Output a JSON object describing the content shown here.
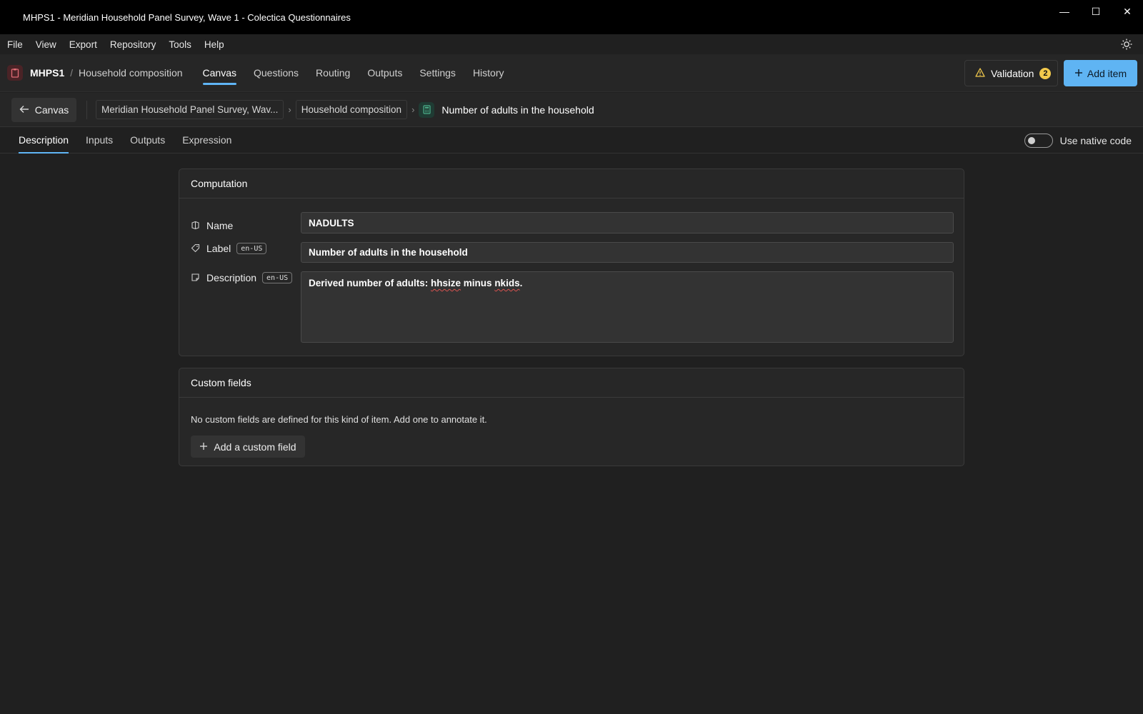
{
  "window": {
    "title": "MHPS1 - Meridian Household Panel Survey, Wave 1 - Colectica Questionnaires",
    "minimize": "—",
    "maximize": "☐",
    "close": "✕"
  },
  "menu": {
    "items": [
      "File",
      "View",
      "Export",
      "Repository",
      "Tools",
      "Help"
    ]
  },
  "topnav": {
    "project": "MHPS1",
    "separator": "/",
    "section": "Household composition",
    "tabs": [
      "Canvas",
      "Questions",
      "Routing",
      "Outputs",
      "Settings",
      "History"
    ],
    "active_tab": "Canvas",
    "validation_label": "Validation",
    "validation_count": "2",
    "add_item_label": "Add item",
    "accent": "#5fb4f3"
  },
  "breadcrumb": {
    "back_label": "Canvas",
    "items": [
      "Meridian Household Panel Survey, Wav...",
      "Household composition"
    ],
    "current": "Number of adults in the household"
  },
  "subtabs": {
    "items": [
      "Description",
      "Inputs",
      "Outputs",
      "Expression"
    ],
    "active": "Description",
    "native_code_label": "Use native code",
    "native_code_on": false
  },
  "computation": {
    "title": "Computation",
    "name_label": "Name",
    "name_value": "NADULTS",
    "label_label": "Label",
    "label_lang": "en-US",
    "label_value": "Number of adults in the household",
    "description_label": "Description",
    "description_lang": "en-US",
    "description_parts": [
      "Derived number of adults: ",
      "hhsize",
      " minus ",
      "nkids",
      "."
    ]
  },
  "custom_fields": {
    "title": "Custom fields",
    "empty_message": "No custom fields are defined for this kind of item. Add one to annotate it.",
    "add_label": "Add a custom field"
  }
}
